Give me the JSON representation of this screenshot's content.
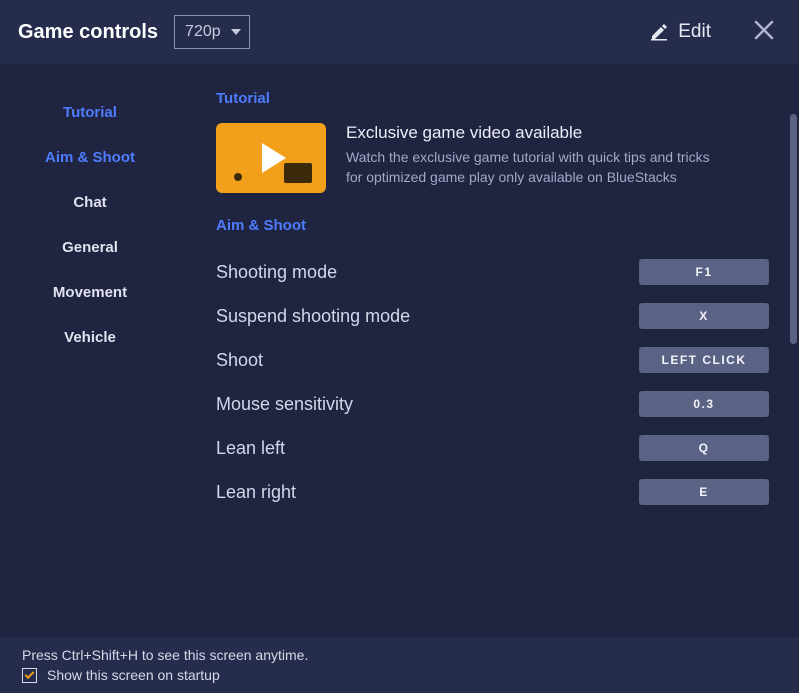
{
  "header": {
    "title": "Game controls",
    "resolution": "720p",
    "edit_label": "Edit"
  },
  "sidebar": {
    "items": [
      {
        "label": "Tutorial",
        "active": true
      },
      {
        "label": "Aim & Shoot",
        "active": true
      },
      {
        "label": "Chat",
        "active": false
      },
      {
        "label": "General",
        "active": false
      },
      {
        "label": "Movement",
        "active": false
      },
      {
        "label": "Vehicle",
        "active": false
      }
    ]
  },
  "content": {
    "tutorial_heading": "Tutorial",
    "tutorial_title": "Exclusive game video available",
    "tutorial_desc": "Watch the exclusive game tutorial with quick tips and tricks for optimized game play only available on BlueStacks",
    "aimshoot_heading": "Aim & Shoot",
    "bindings": [
      {
        "label": "Shooting mode",
        "key": "F1"
      },
      {
        "label": "Suspend shooting mode",
        "key": "X"
      },
      {
        "label": "Shoot",
        "key": "LEFT CLICK"
      },
      {
        "label": "Mouse sensitivity",
        "key": "0.3"
      },
      {
        "label": "Lean left",
        "key": "Q"
      },
      {
        "label": "Lean right",
        "key": "E"
      }
    ]
  },
  "footer": {
    "hint": "Press Ctrl+Shift+H to see this screen anytime.",
    "checkbox_label": "Show this screen on startup",
    "checked": true
  }
}
